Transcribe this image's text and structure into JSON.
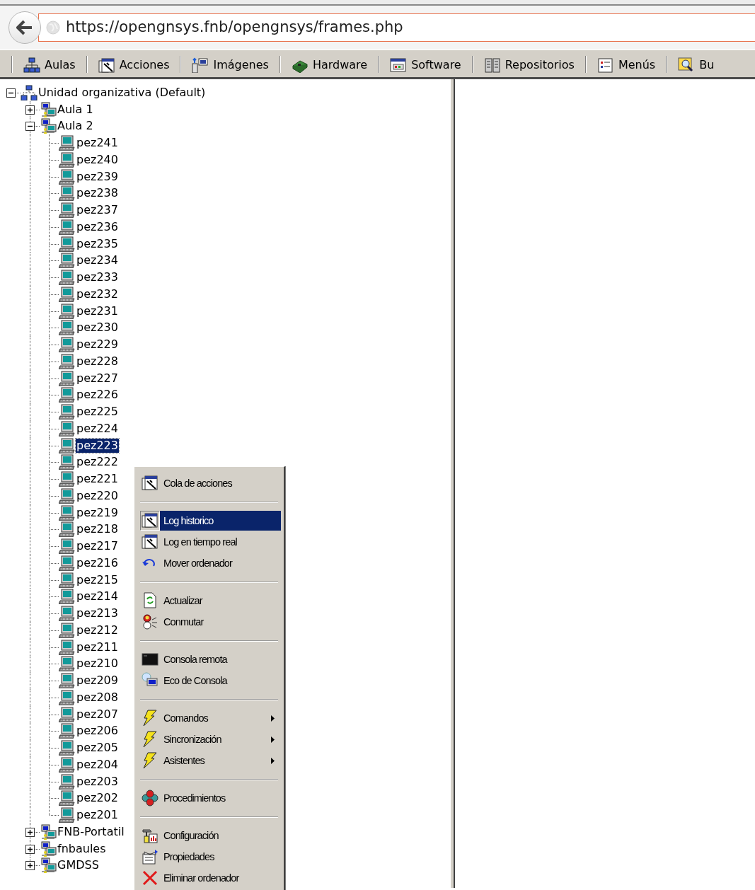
{
  "browser": {
    "url": "https://opengnsys.fnb/opengnsys/frames.php"
  },
  "toolbar": [
    {
      "label": "Aulas"
    },
    {
      "label": "Acciones"
    },
    {
      "label": "Imágenes"
    },
    {
      "label": "Hardware"
    },
    {
      "label": "Software"
    },
    {
      "label": "Repositorios"
    },
    {
      "label": "Menús"
    },
    {
      "label": "Bu"
    }
  ],
  "tree": {
    "label": "Unidad organizativa (Default)",
    "kind": "unit",
    "expanded": true,
    "selected": false,
    "children": [
      {
        "label": "Aula 1",
        "kind": "room",
        "expanded": false,
        "selected": false
      },
      {
        "label": "Aula 2",
        "kind": "room",
        "expanded": true,
        "selected": false,
        "children": [
          {
            "label": "pez241",
            "kind": "computer",
            "selected": false
          },
          {
            "label": "pez240",
            "kind": "computer",
            "selected": false
          },
          {
            "label": "pez239",
            "kind": "computer",
            "selected": false
          },
          {
            "label": "pez238",
            "kind": "computer",
            "selected": false
          },
          {
            "label": "pez237",
            "kind": "computer",
            "selected": false
          },
          {
            "label": "pez236",
            "kind": "computer",
            "selected": false
          },
          {
            "label": "pez235",
            "kind": "computer",
            "selected": false
          },
          {
            "label": "pez234",
            "kind": "computer",
            "selected": false
          },
          {
            "label": "pez233",
            "kind": "computer",
            "selected": false
          },
          {
            "label": "pez232",
            "kind": "computer",
            "selected": false
          },
          {
            "label": "pez231",
            "kind": "computer",
            "selected": false
          },
          {
            "label": "pez230",
            "kind": "computer",
            "selected": false
          },
          {
            "label": "pez229",
            "kind": "computer",
            "selected": false
          },
          {
            "label": "pez228",
            "kind": "computer",
            "selected": false
          },
          {
            "label": "pez227",
            "kind": "computer",
            "selected": false
          },
          {
            "label": "pez226",
            "kind": "computer",
            "selected": false
          },
          {
            "label": "pez225",
            "kind": "computer",
            "selected": false
          },
          {
            "label": "pez224",
            "kind": "computer",
            "selected": false
          },
          {
            "label": "pez223",
            "kind": "computer",
            "selected": true
          },
          {
            "label": "pez222",
            "kind": "computer",
            "selected": false
          },
          {
            "label": "pez221",
            "kind": "computer",
            "selected": false
          },
          {
            "label": "pez220",
            "kind": "computer",
            "selected": false
          },
          {
            "label": "pez219",
            "kind": "computer",
            "selected": false
          },
          {
            "label": "pez218",
            "kind": "computer",
            "selected": false
          },
          {
            "label": "pez217",
            "kind": "computer",
            "selected": false
          },
          {
            "label": "pez216",
            "kind": "computer",
            "selected": false
          },
          {
            "label": "pez215",
            "kind": "computer",
            "selected": false
          },
          {
            "label": "pez214",
            "kind": "computer",
            "selected": false
          },
          {
            "label": "pez213",
            "kind": "computer",
            "selected": false
          },
          {
            "label": "pez212",
            "kind": "computer",
            "selected": false
          },
          {
            "label": "pez211",
            "kind": "computer",
            "selected": false
          },
          {
            "label": "pez210",
            "kind": "computer",
            "selected": false
          },
          {
            "label": "pez209",
            "kind": "computer",
            "selected": false
          },
          {
            "label": "pez208",
            "kind": "computer",
            "selected": false
          },
          {
            "label": "pez207",
            "kind": "computer",
            "selected": false
          },
          {
            "label": "pez206",
            "kind": "computer",
            "selected": false
          },
          {
            "label": "pez205",
            "kind": "computer",
            "selected": false
          },
          {
            "label": "pez204",
            "kind": "computer",
            "selected": false
          },
          {
            "label": "pez203",
            "kind": "computer",
            "selected": false
          },
          {
            "label": "pez202",
            "kind": "computer",
            "selected": false
          },
          {
            "label": "pez201",
            "kind": "computer",
            "selected": false
          }
        ]
      },
      {
        "label": "FNB-Portatil",
        "kind": "room",
        "expanded": false,
        "selected": false
      },
      {
        "label": "fnbaules",
        "kind": "room",
        "expanded": false,
        "selected": false
      },
      {
        "label": "GMDSS",
        "kind": "room",
        "expanded": false,
        "selected": false
      }
    ]
  },
  "context_menu": {
    "groups": [
      [
        {
          "label": "Cola de acciones",
          "selected": false,
          "submenu": false
        }
      ],
      [
        {
          "label": "Log historico",
          "selected": true,
          "submenu": false
        },
        {
          "label": "Log en tiempo real",
          "selected": false,
          "submenu": false
        },
        {
          "label": "Mover ordenador",
          "selected": false,
          "submenu": false
        }
      ],
      [
        {
          "label": "Actualizar",
          "selected": false,
          "submenu": false
        },
        {
          "label": "Conmutar",
          "selected": false,
          "submenu": false
        }
      ],
      [
        {
          "label": "Consola remota",
          "selected": false,
          "submenu": false
        },
        {
          "label": "Eco de Consola",
          "selected": false,
          "submenu": false
        }
      ],
      [
        {
          "label": "Comandos",
          "selected": false,
          "submenu": true
        },
        {
          "label": "Sincronización",
          "selected": false,
          "submenu": true
        },
        {
          "label": "Asistentes",
          "selected": false,
          "submenu": true
        }
      ],
      [
        {
          "label": "Procedimientos",
          "selected": false,
          "submenu": false
        }
      ],
      [
        {
          "label": "Configuración",
          "selected": false,
          "submenu": false
        },
        {
          "label": "Propiedades",
          "selected": false,
          "submenu": false
        },
        {
          "label": "Eliminar ordenador",
          "selected": false,
          "submenu": false
        }
      ]
    ]
  }
}
